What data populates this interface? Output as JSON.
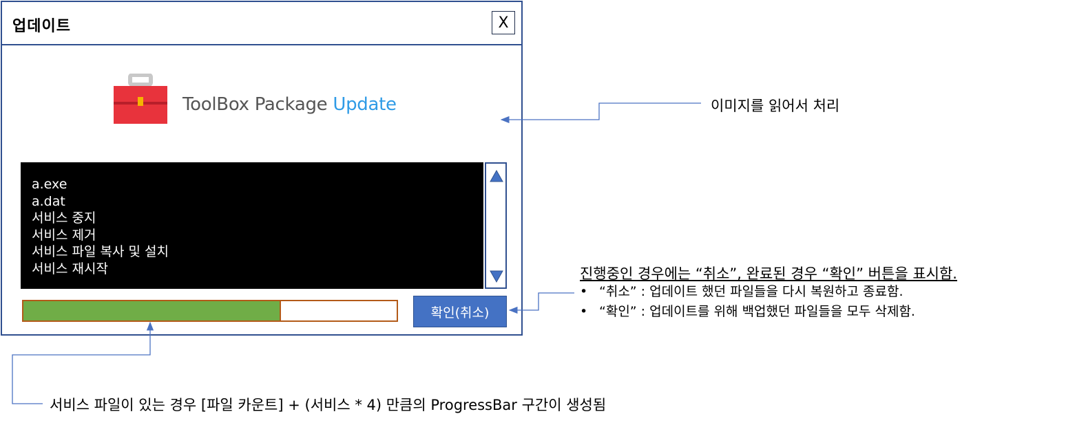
{
  "dialog": {
    "title": "업데이트",
    "close_label": "X",
    "logo": {
      "text_main": "ToolBox Package ",
      "text_accent": "Update",
      "icon": "toolbox-icon",
      "colors": {
        "toolbox": "#e8333c",
        "handle": "#c8c8c8",
        "latch": "#f5b400",
        "accent_text": "#2f9be6"
      }
    },
    "log_items": [
      "a.exe",
      "a.dat",
      "서비스 중지",
      "서비스 제거",
      "서비스 파일 복사 및 설치",
      "서비스 재시작"
    ],
    "scroll_up_icon": "triangle-up-icon",
    "scroll_down_icon": "triangle-down-icon",
    "progress_fraction": 0.69,
    "progress_color": "#70ad47",
    "action_button_label": "확인(취소)",
    "action_button_color": "#4472c4"
  },
  "annotations": {
    "image_note": "이미지를 읽어서 처리",
    "button_note_title": "진행중인 경우에는 “취소”, 완료된 경우 “확인” 버튼을 표시함.",
    "button_note_bullets": [
      "“취소” : 업데이트 했던 파일들을 다시 복원하고 종료함.",
      "“확인” : 업데이트를 위해 백업했던 파일들을 모두 삭제함."
    ],
    "progress_note": "서비스 파일이 있는 경우 [파일 카운트] + (서비스 * 4) 만큼의 ProgressBar 구간이 생성됨",
    "connector_color": "#4a72c2"
  }
}
